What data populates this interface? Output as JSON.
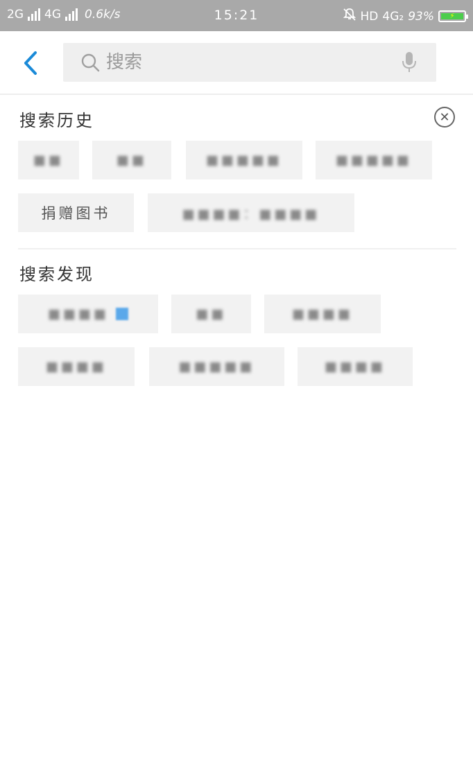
{
  "status_bar": {
    "net1": "2G",
    "net2": "4G",
    "speed": "0.6k/s",
    "time": "15:21",
    "hd": "HD",
    "net3": "4G₂",
    "battery": "93%"
  },
  "header": {
    "back_icon": "chevron-left-icon",
    "search": {
      "placeholder": "搜索",
      "value": ""
    },
    "mic_icon": "microphone-icon"
  },
  "history": {
    "title": "搜索历史",
    "clear_icon": "close-circle-icon",
    "tags": [
      {
        "label": "■■"
      },
      {
        "label": "■■"
      },
      {
        "label": "■■■■■"
      },
      {
        "label": "■■■■■"
      },
      {
        "label": "捐赠图书"
      },
      {
        "label": "■■■■：■■■■"
      }
    ]
  },
  "discover": {
    "title": "搜索发现",
    "tags": [
      {
        "label": "■■■■"
      },
      {
        "label": "■■"
      },
      {
        "label": "■■■■"
      },
      {
        "label": "■■■■"
      },
      {
        "label": "■■■■■"
      },
      {
        "label": "■■■■"
      }
    ]
  },
  "colors": {
    "accent": "#1a8ad8",
    "status_bar": "#a9a9a9",
    "tag_bg": "#f2f2f2"
  }
}
